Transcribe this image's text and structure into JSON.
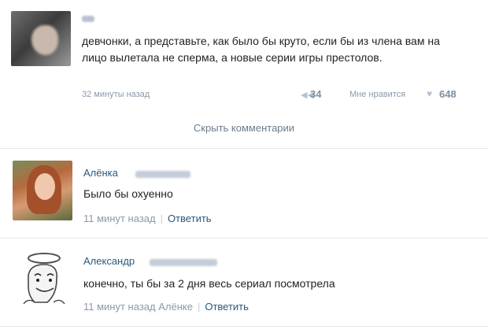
{
  "post": {
    "text": "девчонки, а представьте, как было бы круто, если бы из члена вам на лицо вылетала не сперма, а новые серии игры престолов.",
    "time": "32 минуты назад",
    "reply_count": "34",
    "like_label": "Мне нравится",
    "like_count": "648"
  },
  "hide_comments_label": "Скрыть комментарии",
  "comments": [
    {
      "author": "Алёнка",
      "text": "Было бы охуенно",
      "time": "11 минут назад",
      "separator": "|",
      "reply_label": "Ответить"
    },
    {
      "author": "Александр",
      "text": "конечно, ты бы за 2 дня весь сериал посмотрела",
      "time": "11 минут назад",
      "reply_to": "Алёнке",
      "separator": "|",
      "reply_label": "Ответить"
    }
  ],
  "colors": {
    "link": "#2b587a",
    "meta": "#8a99ab",
    "divider": "#e4e8ed"
  },
  "icons": [
    "reply-arrow-icon",
    "heart-icon"
  ]
}
